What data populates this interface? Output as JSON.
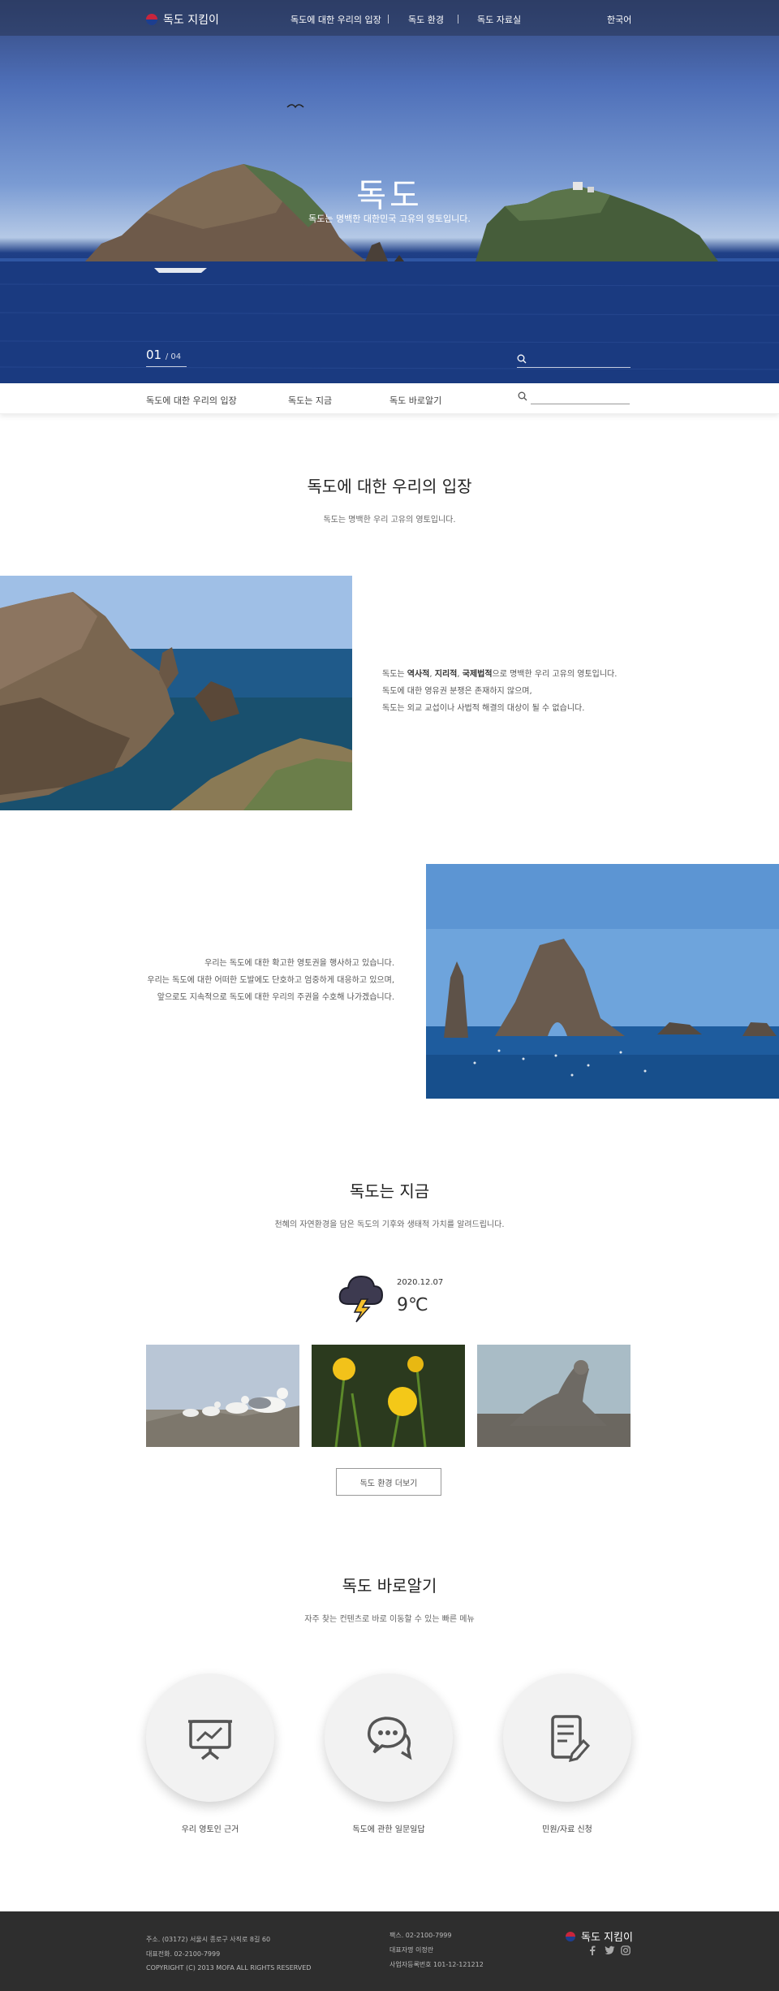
{
  "header": {
    "logo_text": "독도 지킴이",
    "nav": [
      "독도에 대한 우리의 입장",
      "독도 환경",
      "독도 자료실"
    ],
    "language": "한국어"
  },
  "hero": {
    "title": "독도",
    "subtitle": "독도는 명백한 대한민국 고유의 영토입니다.",
    "slide_current": "01",
    "slide_total": "/ 04"
  },
  "subnav": {
    "items": [
      "독도에 대한 우리의 입장",
      "독도는 지금",
      "독도 바로알기"
    ],
    "search_placeholder": ""
  },
  "position": {
    "title": "독도에 대한 우리의 입장",
    "subtitle": "독도는 명백한 우리 고유의 영토입니다.",
    "block1": {
      "line1_pre": "독도는 ",
      "line1_b1": "역사적",
      "line1_sep1": ", ",
      "line1_b2": "지리적",
      "line1_sep2": ", ",
      "line1_b3": "국제법적",
      "line1_post": "으로 명백한 우리 고유의 영토입니다.",
      "line2": "독도에 대한 영유권 분쟁은 존재하지 않으며,",
      "line3": "독도는 외교 교섭이나 사법적 해결의 대상이 될 수 없습니다."
    },
    "block2": {
      "line1": "우리는 독도에 대한 확고한 영토권을 행사하고 있습니다.",
      "line2": "우리는 독도에 대한 어떠한 도발에도 단호하고 엄중하게 대응하고 있으며,",
      "line3": "앞으로도 지속적으로 독도에 대한 우리의 주권을 수호해 나가겠습니다."
    }
  },
  "now": {
    "title": "독도는 지금",
    "subtitle": "천혜의 자연환경을 담은 독도의 기후와 생태적 가치를 알려드립니다.",
    "date": "2020.12.07",
    "temperature": "9℃",
    "weather_icon": "thunderstorm-icon",
    "photos": [
      "seagulls",
      "dandelions",
      "sea-lion"
    ],
    "more_button": "독도 환경 더보기"
  },
  "learn": {
    "title": "독도 바로알기",
    "subtitle": "자주 찾는 컨텐츠로 바로 이동할 수 있는 빠른 메뉴",
    "items": [
      {
        "icon": "presentation-chart-icon",
        "label": "우리 영토인 근거"
      },
      {
        "icon": "chat-bubbles-icon",
        "label": "독도에 관한 일문일답"
      },
      {
        "icon": "document-edit-icon",
        "label": "민원/자료 신청"
      }
    ]
  },
  "footer": {
    "address": "주소. (03172) 서울시 종로구 사직로 8길 60",
    "phone": "대표전화. 02-2100-7999",
    "copyright": "COPYRIGHT (C) 2013 MOFA ALL RIGHTS RESERVED",
    "fax": "팩스. 02-2100-7999",
    "ceo": "대표자명 이정란",
    "biz_no": "사업자등록번호 101-12-121212",
    "logo_text": "독도 지킴이",
    "social": [
      "facebook-icon",
      "twitter-icon",
      "instagram-icon"
    ]
  },
  "colors": {
    "footer_bg": "#2e2e2e",
    "sea_blue": "#163577",
    "brand_red": "#c8253c",
    "brand_blue": "#1d3e8f"
  }
}
